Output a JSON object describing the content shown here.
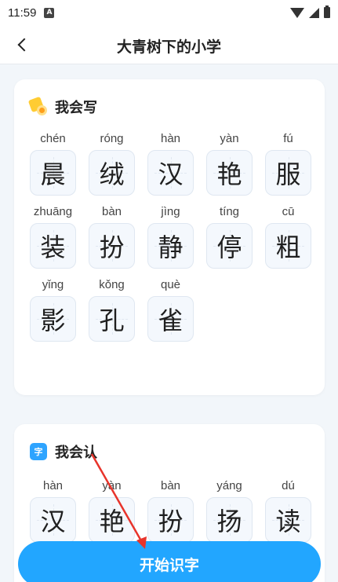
{
  "status_bar": {
    "time": "11:59",
    "app_icon_letter": "A",
    "icons": [
      "wifi-icon",
      "signal-icon",
      "battery-icon"
    ]
  },
  "header": {
    "title": "大青树下的小学",
    "back_icon": "chevron-left-icon"
  },
  "write_section": {
    "label": "我会写",
    "icon": "pencil-badge-icon",
    "rows": [
      [
        {
          "pinyin": "chén",
          "char": "晨"
        },
        {
          "pinyin": "róng",
          "char": "绒"
        },
        {
          "pinyin": "hàn",
          "char": "汉"
        },
        {
          "pinyin": "yàn",
          "char": "艳"
        },
        {
          "pinyin": "fú",
          "char": "服"
        }
      ],
      [
        {
          "pinyin": "zhuāng",
          "char": "装"
        },
        {
          "pinyin": "bàn",
          "char": "扮"
        },
        {
          "pinyin": "jìng",
          "char": "静"
        },
        {
          "pinyin": "tíng",
          "char": "停"
        },
        {
          "pinyin": "cū",
          "char": "粗"
        }
      ],
      [
        {
          "pinyin": "yǐng",
          "char": "影"
        },
        {
          "pinyin": "kǒng",
          "char": "孔"
        },
        {
          "pinyin": "què",
          "char": "雀"
        }
      ]
    ]
  },
  "read_section": {
    "label": "我会认",
    "icon_text": "字",
    "rows": [
      [
        {
          "pinyin": "hàn",
          "char": "汉"
        },
        {
          "pinyin": "yàn",
          "char": "艳"
        },
        {
          "pinyin": "bàn",
          "char": "扮"
        },
        {
          "pinyin": "yáng",
          "char": "扬"
        },
        {
          "pinyin": "dú",
          "char": "读"
        }
      ]
    ]
  },
  "start_button_label": "开始识字",
  "colors": {
    "accent": "#22a6ff",
    "annotation_arrow": "#e8342b",
    "background": "#f2f6fa"
  }
}
